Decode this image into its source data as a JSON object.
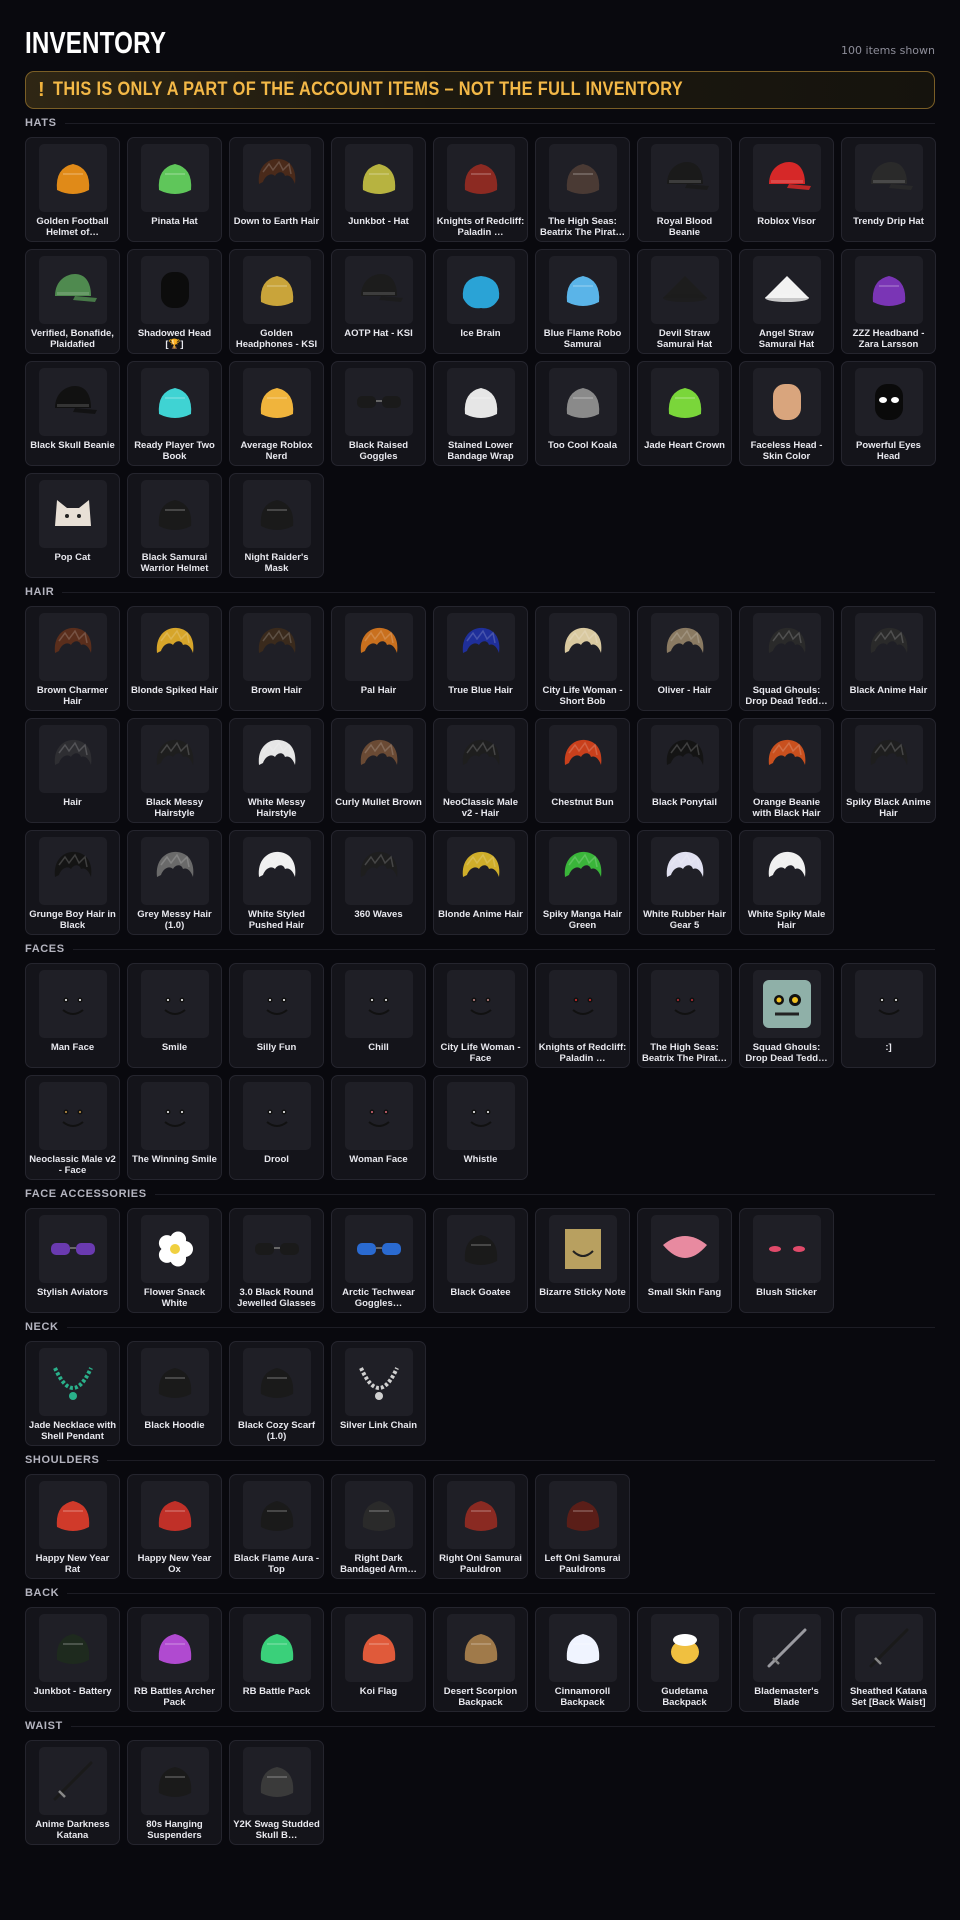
{
  "header": {
    "title": "INVENTORY",
    "count_text": "100 items shown"
  },
  "notice": {
    "icon": "!",
    "text": "THIS IS ONLY A PART OF THE ACCOUNT ITEMS – NOT THE FULL INVENTORY"
  },
  "sections": [
    {
      "title": "HATS",
      "items": [
        {
          "name": "Golden Football Helmet of…",
          "icon": "football-helmet-icon",
          "color": "#e08a18"
        },
        {
          "name": "Pinata Hat",
          "icon": "pinata-icon",
          "color": "#5fc65a"
        },
        {
          "name": "Down to Earth Hair",
          "icon": "hair-icon",
          "color": "#4a2a1a"
        },
        {
          "name": "Junkbot - Hat",
          "icon": "junkbot-hat-icon",
          "color": "#b7b340"
        },
        {
          "name": "Knights of Redcliff: Paladin …",
          "icon": "helmet-icon",
          "color": "#8c2a22"
        },
        {
          "name": "The High Seas: Beatrix The Pirat…",
          "icon": "pirate-hat-icon",
          "color": "#4a3a34"
        },
        {
          "name": "Royal Blood Beanie",
          "icon": "beanie-icon",
          "color": "#1a1a1a"
        },
        {
          "name": "Roblox Visor",
          "icon": "visor-icon",
          "color": "#d62828"
        },
        {
          "name": "Trendy Drip Hat",
          "icon": "bucket-hat-icon",
          "color": "#2a2a2a"
        },
        {
          "name": "Verified, Bonafide, Plaidafied",
          "icon": "plaid-cap-icon",
          "color": "#4f8a4f"
        },
        {
          "name": "Shadowed Head [🏆]",
          "icon": "shadow-head-icon",
          "color": "#0c0c0c"
        },
        {
          "name": "Golden Headphones - KSI",
          "icon": "headphones-icon",
          "color": "#c9a43a"
        },
        {
          "name": "AOTP Hat - KSI",
          "icon": "cap-icon",
          "color": "#1c1c1c"
        },
        {
          "name": "Ice Brain",
          "icon": "brain-icon",
          "color": "#2aa3d6"
        },
        {
          "name": "Blue Flame Robo Samurai",
          "icon": "robo-samurai-icon",
          "color": "#5ab4e8"
        },
        {
          "name": "Devil Straw Samurai Hat",
          "icon": "straw-hat-icon",
          "color": "#1d1d1d"
        },
        {
          "name": "Angel Straw Samurai Hat",
          "icon": "straw-hat-white-icon",
          "color": "#f2f2f2"
        },
        {
          "name": "ZZZ Headband - Zara Larsson",
          "icon": "headband-icon",
          "color": "#7a35b5"
        },
        {
          "name": "Black Skull Beanie",
          "icon": "skull-beanie-icon",
          "color": "#111111"
        },
        {
          "name": "Ready Player Two Book",
          "icon": "book-icon",
          "color": "#3fd3d3"
        },
        {
          "name": "Average Roblox Nerd",
          "icon": "nerd-face-icon",
          "color": "#f0b43c"
        },
        {
          "name": "Black Raised Goggles",
          "icon": "goggles-icon",
          "color": "#1a1a1a"
        },
        {
          "name": "Stained Lower Bandage Wrap",
          "icon": "bandage-icon",
          "color": "#e6e6e6"
        },
        {
          "name": "Too Cool Koala",
          "icon": "koala-icon",
          "color": "#8a8a8a"
        },
        {
          "name": "Jade Heart Crown",
          "icon": "crown-icon",
          "color": "#7ad63a"
        },
        {
          "name": "Faceless Head - Skin Color",
          "icon": "head-icon",
          "color": "#d9a57d"
        },
        {
          "name": "Powerful Eyes Head",
          "icon": "glowing-eyes-head-icon",
          "color": "#0a0a0a"
        },
        {
          "name": "Pop Cat",
          "icon": "cat-icon",
          "color": "#e8e0d6"
        },
        {
          "name": "Black Samurai Warrior Helmet",
          "icon": "samurai-helmet-icon",
          "color": "#1a1a1a"
        },
        {
          "name": "Night Raider's Mask",
          "icon": "mask-icon",
          "color": "#1a1a1a"
        }
      ]
    },
    {
      "title": "HAIR",
      "items": [
        {
          "name": "Brown Charmer Hair",
          "icon": "hair-icon",
          "color": "#5a2e1c"
        },
        {
          "name": "Blonde Spiked Hair",
          "icon": "hair-icon",
          "color": "#d6a52a"
        },
        {
          "name": "Brown Hair",
          "icon": "hair-icon",
          "color": "#3a2a1c"
        },
        {
          "name": "Pal Hair",
          "icon": "hair-icon",
          "color": "#c9701e"
        },
        {
          "name": "True Blue Hair",
          "icon": "hair-icon",
          "color": "#1f2f9a"
        },
        {
          "name": "City Life Woman - Short Bob",
          "icon": "hair-icon",
          "color": "#d9c9a0"
        },
        {
          "name": "Oliver - Hair",
          "icon": "hair-icon",
          "color": "#8a7a62"
        },
        {
          "name": "Squad Ghouls: Drop Dead Tedd…",
          "icon": "hair-icon",
          "color": "#2a2a2a"
        },
        {
          "name": "Black Anime Hair",
          "icon": "hair-icon",
          "color": "#2a2a2a"
        },
        {
          "name": "Hair",
          "icon": "hair-icon",
          "color": "#2e2e32"
        },
        {
          "name": "Black Messy Hairstyle",
          "icon": "hair-icon",
          "color": "#1e1e1e"
        },
        {
          "name": "White Messy Hairstyle",
          "icon": "hair-icon",
          "color": "#e6e6e6"
        },
        {
          "name": "Curly Mullet Brown",
          "icon": "hair-icon",
          "color": "#6a4a34"
        },
        {
          "name": "NeoClassic Male v2 - Hair",
          "icon": "hair-icon",
          "color": "#1e1e1e"
        },
        {
          "name": "Chestnut Bun",
          "icon": "hair-icon",
          "color": "#c9401c"
        },
        {
          "name": "Black Ponytail",
          "icon": "hair-icon",
          "color": "#141414"
        },
        {
          "name": "Orange Beanie with Black Hair",
          "icon": "hair-icon",
          "color": "#c9501e"
        },
        {
          "name": "Spiky Black Anime Hair",
          "icon": "hair-icon",
          "color": "#1e1e1e"
        },
        {
          "name": "Grunge Boy Hair in Black",
          "icon": "hair-icon",
          "color": "#141414"
        },
        {
          "name": "Grey Messy Hair (1.0)",
          "icon": "hair-icon",
          "color": "#6a6a6a"
        },
        {
          "name": "White Styled Pushed Hair",
          "icon": "hair-icon",
          "color": "#f0f0f0"
        },
        {
          "name": "360 Waves",
          "icon": "hair-icon",
          "color": "#1e1e1e"
        },
        {
          "name": "Blonde Anime Hair",
          "icon": "hair-icon",
          "color": "#cfae2a"
        },
        {
          "name": "Spiky Manga Hair Green",
          "icon": "hair-icon",
          "color": "#3ab53a"
        },
        {
          "name": "White Rubber Hair Gear 5",
          "icon": "hair-icon",
          "color": "#e0e0f0"
        },
        {
          "name": "White Spiky Male Hair",
          "icon": "hair-icon",
          "color": "#f0f0f0"
        }
      ]
    },
    {
      "title": "FACES",
      "items": [
        {
          "name": "Man Face",
          "icon": "face-icon",
          "color": "#ffffff"
        },
        {
          "name": "Smile",
          "icon": "face-icon",
          "color": "#ffffff"
        },
        {
          "name": "Silly Fun",
          "icon": "face-icon",
          "color": "#ffffff"
        },
        {
          "name": "Chill",
          "icon": "face-icon",
          "color": "#ffffff"
        },
        {
          "name": "City Life Woman - Face",
          "icon": "face-icon",
          "color": "#c88a8a"
        },
        {
          "name": "Knights of Redcliff: Paladin …",
          "icon": "face-icon",
          "color": "#e03030"
        },
        {
          "name": "The High Seas: Beatrix The Pirat…",
          "icon": "face-icon",
          "color": "#c0303a"
        },
        {
          "name": "Squad Ghouls: Drop Dead Tedd…",
          "icon": "zombie-face-icon",
          "color": "#8fb0a8"
        },
        {
          "name": ":]",
          "icon": "face-icon",
          "color": "#ffffff"
        },
        {
          "name": "Neoclassic Male v2 - Face",
          "icon": "face-icon",
          "color": "#c89a4a"
        },
        {
          "name": "The Winning Smile",
          "icon": "face-icon",
          "color": "#ffffff"
        },
        {
          "name": "Drool",
          "icon": "face-icon",
          "color": "#ffffff"
        },
        {
          "name": "Woman Face",
          "icon": "face-icon",
          "color": "#e06a7a"
        },
        {
          "name": "Whistle",
          "icon": "face-icon",
          "color": "#ffffff"
        }
      ]
    },
    {
      "title": "FACE ACCESSORIES",
      "items": [
        {
          "name": "Stylish Aviators",
          "icon": "sunglasses-icon",
          "color": "#6a3ab0"
        },
        {
          "name": "Flower Snack White",
          "icon": "flower-icon",
          "color": "#ffffff"
        },
        {
          "name": "3.0 Black Round Jewelled Glasses",
          "icon": "glasses-icon",
          "color": "#1a1a1a"
        },
        {
          "name": "Arctic Techwear Goggles…",
          "icon": "goggles-icon",
          "color": "#2a6ad0"
        },
        {
          "name": "Black Goatee",
          "icon": "goatee-icon",
          "color": "#1a1a1a"
        },
        {
          "name": "Bizarre Sticky Note",
          "icon": "sticky-note-icon",
          "color": "#b8a060"
        },
        {
          "name": "Small Skin Fang",
          "icon": "fang-icon",
          "color": "#e88aa0"
        },
        {
          "name": "Blush Sticker",
          "icon": "blush-icon",
          "color": "#e04a6a"
        }
      ]
    },
    {
      "title": "NECK",
      "items": [
        {
          "name": "Jade Necklace with Shell Pendant",
          "icon": "necklace-icon",
          "color": "#2ab08a"
        },
        {
          "name": "Black Hoodie",
          "icon": "hoodie-icon",
          "color": "#1a1a1a"
        },
        {
          "name": "Black Cozy Scarf (1.0)",
          "icon": "scarf-icon",
          "color": "#1a1a1a"
        },
        {
          "name": "Silver Link Chain",
          "icon": "chain-icon",
          "color": "#d0d0d0"
        }
      ]
    },
    {
      "title": "SHOULDERS",
      "items": [
        {
          "name": "Happy New Year Rat",
          "icon": "rat-icon",
          "color": "#d03a2a"
        },
        {
          "name": "Happy New Year Ox",
          "icon": "ox-icon",
          "color": "#c03028"
        },
        {
          "name": "Black Flame Aura - Top",
          "icon": "aura-icon",
          "color": "#1a1a1a"
        },
        {
          "name": "Right Dark Bandaged Arm…",
          "icon": "arm-icon",
          "color": "#2a2a2a"
        },
        {
          "name": "Right Oni Samurai Pauldron",
          "icon": "pauldron-icon",
          "color": "#8a2a22"
        },
        {
          "name": "Left Oni Samurai Pauldrons",
          "icon": "pauldron-icon",
          "color": "#5a1e18"
        }
      ]
    },
    {
      "title": "BACK",
      "items": [
        {
          "name": "Junkbot - Battery",
          "icon": "battery-icon",
          "color": "#1e2a1e"
        },
        {
          "name": "RB Battles Archer Pack",
          "icon": "bow-icon",
          "color": "#b04ad0"
        },
        {
          "name": "RB Battle Pack",
          "icon": "backpack-icon",
          "color": "#3ad07a"
        },
        {
          "name": "Koi Flag",
          "icon": "koi-flag-icon",
          "color": "#e05a3a"
        },
        {
          "name": "Desert Scorpion Backpack",
          "icon": "scorpion-icon",
          "color": "#a07a4a"
        },
        {
          "name": "Cinnamoroll Backpack",
          "icon": "cinnamoroll-icon",
          "color": "#f0f4ff"
        },
        {
          "name": "Gudetama Backpack",
          "icon": "egg-icon",
          "color": "#f0c040"
        },
        {
          "name": "Blademaster's Blade",
          "icon": "sword-icon",
          "color": "#9a9aa0"
        },
        {
          "name": "Sheathed Katana Set [Back Waist]",
          "icon": "katana-icon",
          "color": "#1a1a1a"
        }
      ]
    },
    {
      "title": "WAIST",
      "items": [
        {
          "name": "Anime Darkness Katana",
          "icon": "katana-icon",
          "color": "#1a1a1a"
        },
        {
          "name": "80s Hanging Suspenders",
          "icon": "suspenders-icon",
          "color": "#1a1a1a"
        },
        {
          "name": "Y2K Swag Studded Skull B…",
          "icon": "belt-icon",
          "color": "#3a3a3a"
        }
      ]
    }
  ]
}
